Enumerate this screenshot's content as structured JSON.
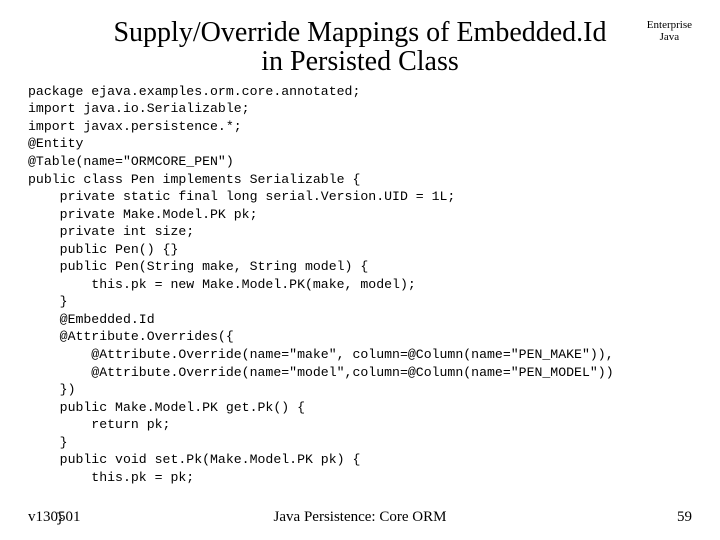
{
  "header": {
    "title_line1": "Supply/Override Mappings of Embedded.Id",
    "title_line2": "in Persisted Class",
    "top_right_line1": "Enterprise",
    "top_right_line2": "Java"
  },
  "code": "package ejava.examples.orm.core.annotated;\nimport java.io.Serializable;\nimport javax.persistence.*;\n@Entity\n@Table(name=\"ORMCORE_PEN\")\npublic class Pen implements Serializable {\n    private static final long serial.Version.UID = 1L;\n    private Make.Model.PK pk;\n    private int size;\n    public Pen() {}\n    public Pen(String make, String model) {\n        this.pk = new Make.Model.PK(make, model);\n    }\n    @Embedded.Id\n    @Attribute.Overrides({\n        @Attribute.Override(name=\"make\", column=@Column(name=\"PEN_MAKE\")),\n        @Attribute.Override(name=\"model\",column=@Column(name=\"PEN_MODEL\"))\n    })\n    public Make.Model.PK get.Pk() {\n        return pk;\n    }\n    public void set.Pk(Make.Model.PK pk) {\n        this.pk = pk;",
  "closing_brace": "}",
  "footer": {
    "left": "v130501",
    "center": "Java Persistence: Core ORM",
    "right": "59"
  }
}
